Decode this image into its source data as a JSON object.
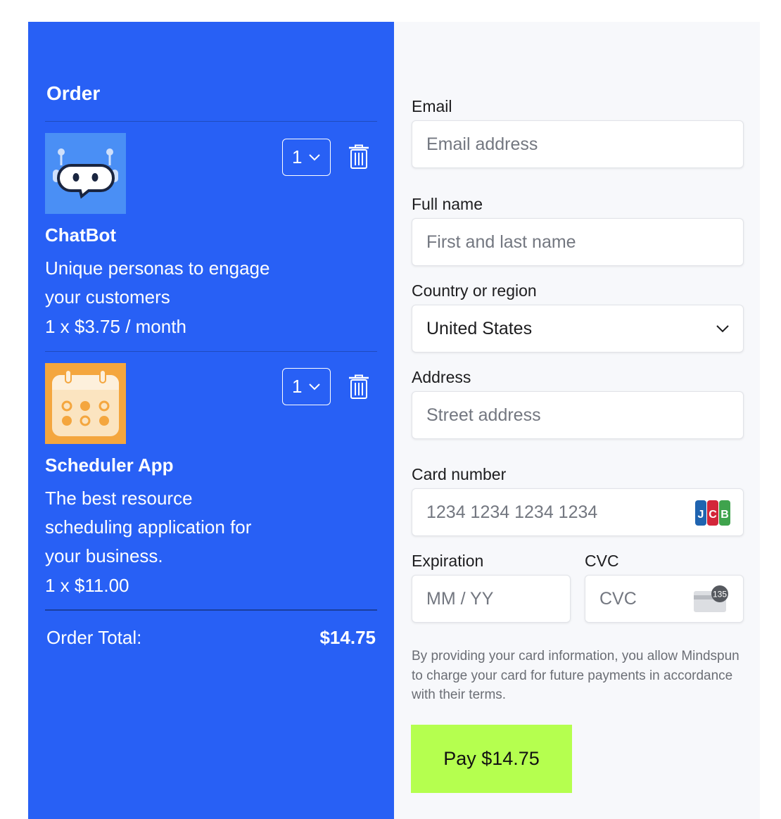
{
  "colors": {
    "accent": "#2860f5",
    "pay_button": "#b5ff4f"
  },
  "order": {
    "title": "Order",
    "items": [
      {
        "name": "ChatBot",
        "description": "Unique personas to engage your customers",
        "price_line": "1 x $3.75 / month",
        "quantity": "1",
        "icon": "chatbot-icon"
      },
      {
        "name": "Scheduler App",
        "description": "The best resource scheduling application for your business.",
        "price_line": "1 x $11.00",
        "quantity": "1",
        "icon": "calendar-icon"
      }
    ],
    "total_label": "Order Total:",
    "total_value": "$14.75"
  },
  "form": {
    "email": {
      "label": "Email",
      "placeholder": "Email address"
    },
    "full_name": {
      "label": "Full name",
      "placeholder": "First and last name"
    },
    "country": {
      "label": "Country or region",
      "value": "United States"
    },
    "address": {
      "label": "Address",
      "placeholder": "Street address"
    },
    "card_number": {
      "label": "Card number",
      "placeholder": "1234 1234 1234 1234",
      "brand": "JCB"
    },
    "expiration": {
      "label": "Expiration",
      "placeholder": "MM / YY"
    },
    "cvc": {
      "label": "CVC",
      "placeholder": "CVC",
      "hint": "135"
    },
    "disclaimer": "By providing your card information, you allow Mindspun to charge your card for future payments in accordance with their terms.",
    "pay_label": "Pay $14.75"
  }
}
